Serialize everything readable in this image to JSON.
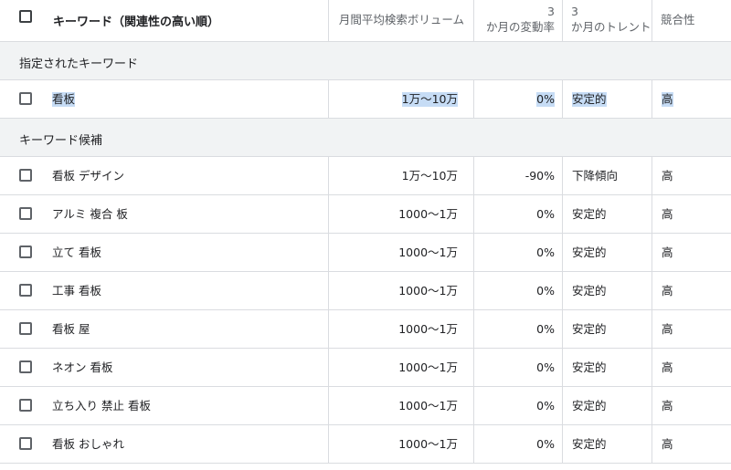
{
  "header": {
    "keyword": "キーワード（関連性の高い順）",
    "volume": "月間平均検索ボリューム",
    "change_line1": "3",
    "change_line2": "か月の変動率",
    "trend_line1": "3",
    "trend_line2": "か月のトレント",
    "competition": "競合性"
  },
  "groups": {
    "specified": "指定されたキーワード",
    "suggestions": "キーワード候補"
  },
  "specified_rows": [
    {
      "keyword": "看板",
      "volume": "1万～10万",
      "change": "0%",
      "trend": "安定的",
      "competition": "高"
    }
  ],
  "suggestion_rows": [
    {
      "keyword": "看板 デザイン",
      "volume": "1万～10万",
      "change": "-90%",
      "trend": "下降傾向",
      "competition": "高"
    },
    {
      "keyword": "アルミ 複合 板",
      "volume": "1000～1万",
      "change": "0%",
      "trend": "安定的",
      "competition": "高"
    },
    {
      "keyword": "立て 看板",
      "volume": "1000～1万",
      "change": "0%",
      "trend": "安定的",
      "competition": "高"
    },
    {
      "keyword": "工事 看板",
      "volume": "1000～1万",
      "change": "0%",
      "trend": "安定的",
      "competition": "高"
    },
    {
      "keyword": "看板 屋",
      "volume": "1000～1万",
      "change": "0%",
      "trend": "安定的",
      "competition": "高"
    },
    {
      "keyword": "ネオン 看板",
      "volume": "1000～1万",
      "change": "0%",
      "trend": "安定的",
      "competition": "高"
    },
    {
      "keyword": "立ち入り 禁止 看板",
      "volume": "1000～1万",
      "change": "0%",
      "trend": "安定的",
      "competition": "高"
    },
    {
      "keyword": "看板 おしゃれ",
      "volume": "1000～1万",
      "change": "0%",
      "trend": "安定的",
      "competition": "高"
    }
  ]
}
